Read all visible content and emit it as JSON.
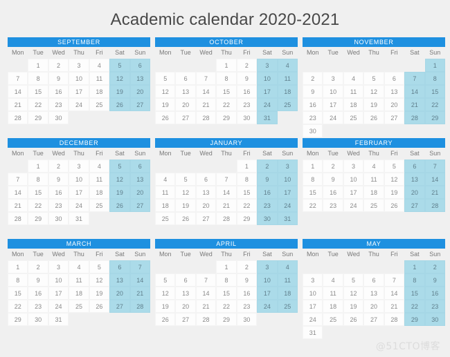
{
  "page": {
    "title": "Academic calendar 2020-2021",
    "watermark": "@51CTO博客",
    "background_color": "#f0f0f0",
    "header_color": "#1e90e0",
    "weekend_color": "#abdbe9",
    "weekday_color": "#fdfdfd",
    "title_color": "#484848"
  },
  "weekday_labels": [
    "Mon",
    "Tue",
    "Wed",
    "Thu",
    "Fri",
    "Sat",
    "Sun"
  ],
  "weekend_indices": [
    5,
    6
  ],
  "months": [
    {
      "name": "SEPTEMBER",
      "year": 2020,
      "start_weekday_index": 1,
      "days_in_month": 30,
      "weeks": [
        [
          null,
          1,
          2,
          3,
          4,
          5,
          6
        ],
        [
          7,
          8,
          9,
          10,
          11,
          12,
          13
        ],
        [
          14,
          15,
          16,
          17,
          18,
          19,
          20
        ],
        [
          21,
          22,
          23,
          24,
          25,
          26,
          27
        ],
        [
          28,
          29,
          30,
          null,
          null,
          null,
          null
        ]
      ]
    },
    {
      "name": "OCTOBER",
      "year": 2020,
      "start_weekday_index": 3,
      "days_in_month": 31,
      "weeks": [
        [
          null,
          null,
          null,
          1,
          2,
          3,
          4
        ],
        [
          5,
          6,
          7,
          8,
          9,
          10,
          11
        ],
        [
          12,
          13,
          14,
          15,
          16,
          17,
          18
        ],
        [
          19,
          20,
          21,
          22,
          23,
          24,
          25
        ],
        [
          26,
          27,
          28,
          29,
          30,
          31,
          null
        ]
      ]
    },
    {
      "name": "NOVEMBER",
      "year": 2020,
      "start_weekday_index": 6,
      "days_in_month": 30,
      "weeks": [
        [
          null,
          null,
          null,
          null,
          null,
          null,
          1
        ],
        [
          2,
          3,
          4,
          5,
          6,
          7,
          8
        ],
        [
          9,
          10,
          11,
          12,
          13,
          14,
          15
        ],
        [
          16,
          17,
          18,
          19,
          20,
          21,
          22
        ],
        [
          23,
          24,
          25,
          26,
          27,
          28,
          29
        ],
        [
          30,
          null,
          null,
          null,
          null,
          null,
          null
        ]
      ]
    },
    {
      "name": "DECEMBER",
      "year": 2020,
      "start_weekday_index": 1,
      "days_in_month": 31,
      "weeks": [
        [
          null,
          1,
          2,
          3,
          4,
          5,
          6
        ],
        [
          7,
          8,
          9,
          10,
          11,
          12,
          13
        ],
        [
          14,
          15,
          16,
          17,
          18,
          19,
          20
        ],
        [
          21,
          22,
          23,
          24,
          25,
          26,
          27
        ],
        [
          28,
          29,
          30,
          31,
          null,
          null,
          null
        ]
      ]
    },
    {
      "name": "JANUARY",
      "year": 2021,
      "start_weekday_index": 4,
      "days_in_month": 31,
      "weeks": [
        [
          null,
          null,
          null,
          null,
          1,
          2,
          3
        ],
        [
          4,
          5,
          6,
          7,
          8,
          9,
          10
        ],
        [
          11,
          12,
          13,
          14,
          15,
          16,
          17
        ],
        [
          18,
          19,
          20,
          21,
          22,
          23,
          24
        ],
        [
          25,
          26,
          27,
          28,
          29,
          30,
          31
        ]
      ]
    },
    {
      "name": "FEBRUARY",
      "year": 2021,
      "start_weekday_index": 0,
      "days_in_month": 28,
      "weeks": [
        [
          1,
          2,
          3,
          4,
          5,
          6,
          7
        ],
        [
          8,
          9,
          10,
          11,
          12,
          13,
          14
        ],
        [
          15,
          16,
          17,
          18,
          19,
          20,
          21
        ],
        [
          22,
          23,
          24,
          25,
          26,
          27,
          28
        ]
      ]
    },
    {
      "name": "MARCH",
      "year": 2021,
      "start_weekday_index": 0,
      "days_in_month": 31,
      "weeks": [
        [
          1,
          2,
          3,
          4,
          5,
          6,
          7
        ],
        [
          8,
          9,
          10,
          11,
          12,
          13,
          14
        ],
        [
          15,
          16,
          17,
          18,
          19,
          20,
          21
        ],
        [
          22,
          23,
          24,
          25,
          26,
          27,
          28
        ],
        [
          29,
          30,
          31,
          null,
          null,
          null,
          null
        ]
      ]
    },
    {
      "name": "APRIL",
      "year": 2021,
      "start_weekday_index": 3,
      "days_in_month": 30,
      "weeks": [
        [
          null,
          null,
          null,
          1,
          2,
          3,
          4
        ],
        [
          5,
          6,
          7,
          8,
          9,
          10,
          11
        ],
        [
          12,
          13,
          14,
          15,
          16,
          17,
          18
        ],
        [
          19,
          20,
          21,
          22,
          23,
          24,
          25
        ],
        [
          26,
          27,
          28,
          29,
          30,
          null,
          null
        ]
      ]
    },
    {
      "name": "MAY",
      "year": 2021,
      "start_weekday_index": 5,
      "days_in_month": 31,
      "weeks": [
        [
          null,
          null,
          null,
          null,
          null,
          1,
          2
        ],
        [
          3,
          4,
          5,
          6,
          7,
          8,
          9
        ],
        [
          10,
          11,
          12,
          13,
          14,
          15,
          16
        ],
        [
          17,
          18,
          19,
          20,
          21,
          22,
          23
        ],
        [
          24,
          25,
          26,
          27,
          28,
          29,
          30
        ],
        [
          31,
          null,
          null,
          null,
          null,
          null,
          null
        ]
      ]
    }
  ]
}
